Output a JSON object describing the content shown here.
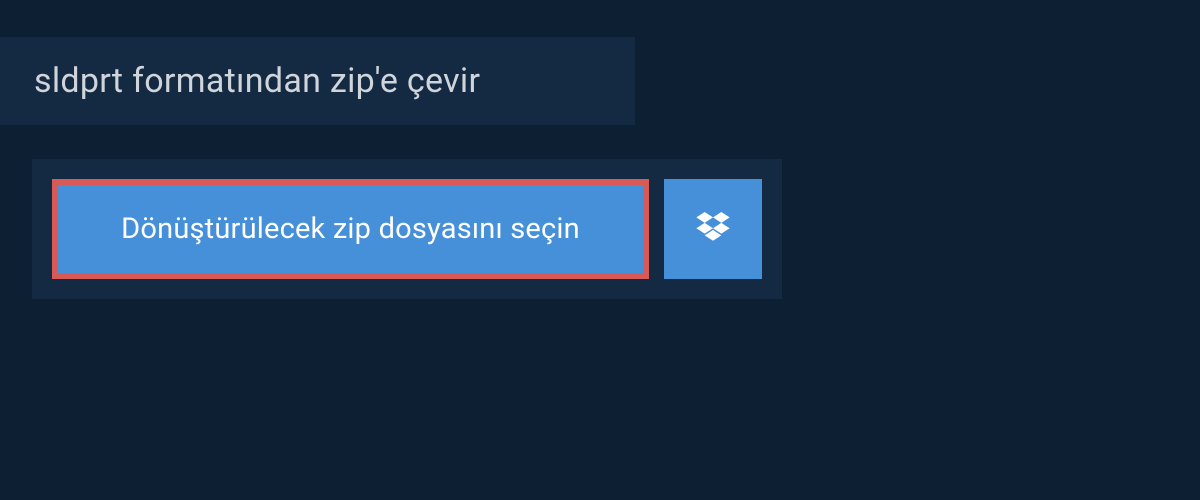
{
  "header": {
    "title": "sldprt formatından zip'e çevir"
  },
  "upload": {
    "select_file_label": "Dönüştürülecek zip dosyasını seçin",
    "dropbox_icon": "dropbox"
  }
}
